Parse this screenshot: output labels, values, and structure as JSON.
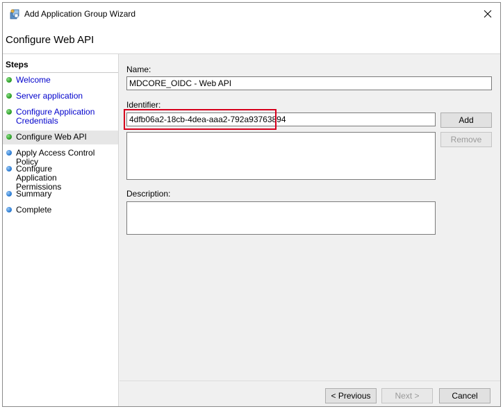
{
  "window": {
    "title": "Add Application Group Wizard",
    "close_icon": "close-icon"
  },
  "header": {
    "title": "Configure Web API"
  },
  "steps": {
    "heading": "Steps",
    "items": [
      {
        "label": "Welcome",
        "status": "done"
      },
      {
        "label": "Server application",
        "status": "done"
      },
      {
        "label": "Configure Application Credentials",
        "status": "done"
      },
      {
        "label": "Configure Web API",
        "status": "current"
      },
      {
        "label": "Apply Access Control Policy",
        "status": "todo"
      },
      {
        "label": "Configure Application Permissions",
        "status": "todo"
      },
      {
        "label": "Summary",
        "status": "todo"
      },
      {
        "label": "Complete",
        "status": "todo"
      }
    ]
  },
  "form": {
    "name_label": "Name:",
    "name_value": "MDCORE_OIDC - Web API",
    "identifier_label": "Identifier:",
    "identifier_value": "4dfb06a2-18cb-4dea-aaa2-792a93763894",
    "add_label": "Add",
    "remove_label": "Remove",
    "identifier_list": "",
    "description_label": "Description:",
    "description_value": ""
  },
  "footer": {
    "previous_label": "< Previous",
    "next_label": "Next >",
    "cancel_label": "Cancel"
  },
  "colors": {
    "highlight": "#d6001c",
    "link": "#0000cc",
    "done_dot": "#2fa12a",
    "todo_dot": "#2f7fd6"
  }
}
